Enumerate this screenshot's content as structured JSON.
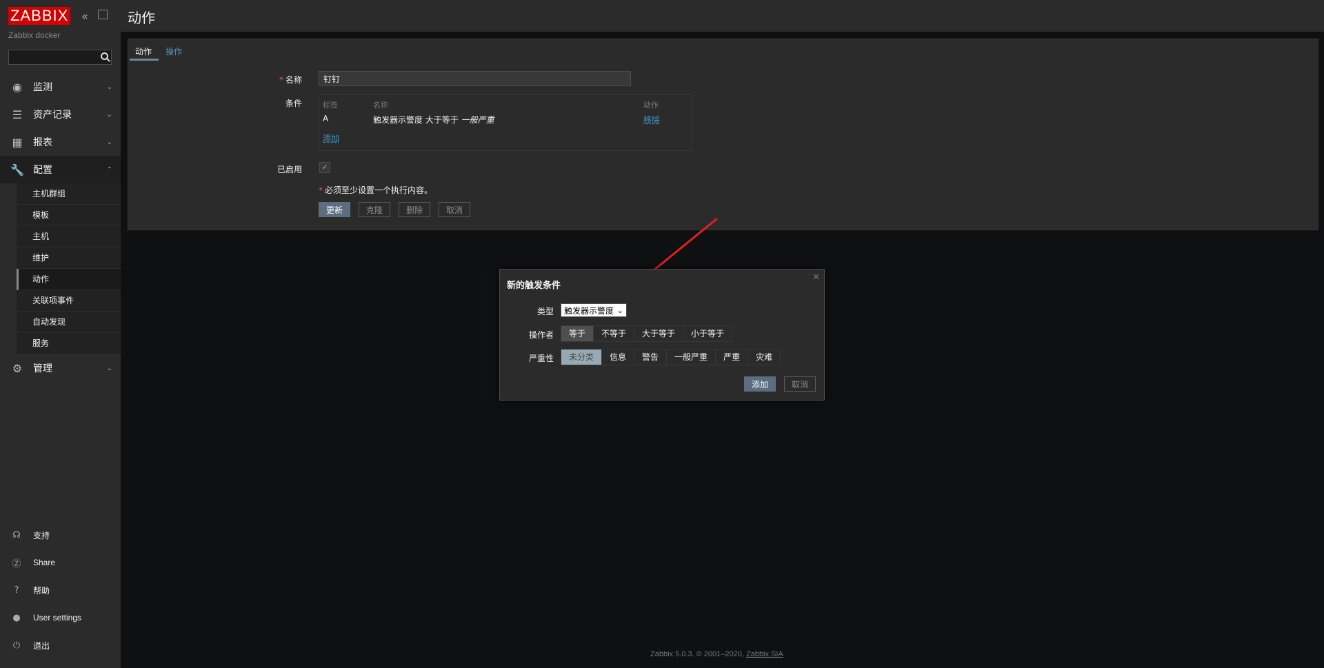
{
  "sidebar": {
    "logo": "ZABBIX",
    "server_name": "Zabbix docker",
    "search_placeholder": "",
    "menu": [
      {
        "label": "监测",
        "icon": "eye-icon"
      },
      {
        "label": "资产记录",
        "icon": "list-icon"
      },
      {
        "label": "报表",
        "icon": "chart-icon"
      },
      {
        "label": "配置",
        "icon": "wrench-icon"
      },
      {
        "label": "管理",
        "icon": "gear-icon"
      }
    ],
    "config_sub": [
      "主机群组",
      "模板",
      "主机",
      "维护",
      "动作",
      "关联项事件",
      "自动发现",
      "服务"
    ],
    "bottom": [
      {
        "label": "支持",
        "icon": "headset-icon"
      },
      {
        "label": "Share",
        "icon": "share-icon"
      },
      {
        "label": "帮助",
        "icon": "help-icon"
      },
      {
        "label": "User settings",
        "icon": "user-icon"
      },
      {
        "label": "退出",
        "icon": "power-icon"
      }
    ]
  },
  "header": {
    "title": "动作"
  },
  "tabs": {
    "action": "动作",
    "operations": "操作"
  },
  "form": {
    "name_label": "名称",
    "name_value": "钉钉",
    "conditions_label": "条件",
    "cond_headers": {
      "tag": "标签",
      "name": "名称",
      "action": "动作"
    },
    "cond_row": {
      "tag": "A",
      "name_prefix": "触发器示警度 大于等于 ",
      "name_value": "一般严重",
      "remove": "移除"
    },
    "add_link": "添加",
    "enabled_label": "已启用",
    "warning": "必须至少设置一个执行内容。",
    "buttons": {
      "update": "更新",
      "clone": "克隆",
      "delete": "删除",
      "cancel": "取消"
    }
  },
  "modal": {
    "title": "新的触发条件",
    "type_label": "类型",
    "type_value": "触发器示警度",
    "operator_label": "操作者",
    "operators": [
      "等于",
      "不等于",
      "大于等于",
      "小于等于"
    ],
    "severity_label": "严重性",
    "severities": [
      "未分类",
      "信息",
      "警告",
      "一般严重",
      "严重",
      "灾难"
    ],
    "add_button": "添加",
    "cancel_button": "取消"
  },
  "footer": {
    "text": "Zabbix 5.0.3. © 2001–2020, ",
    "link": "Zabbix SIA"
  },
  "colors": {
    "brand": "#d40000",
    "link": "#4796c4",
    "annotation_arrow": "#e02020"
  }
}
